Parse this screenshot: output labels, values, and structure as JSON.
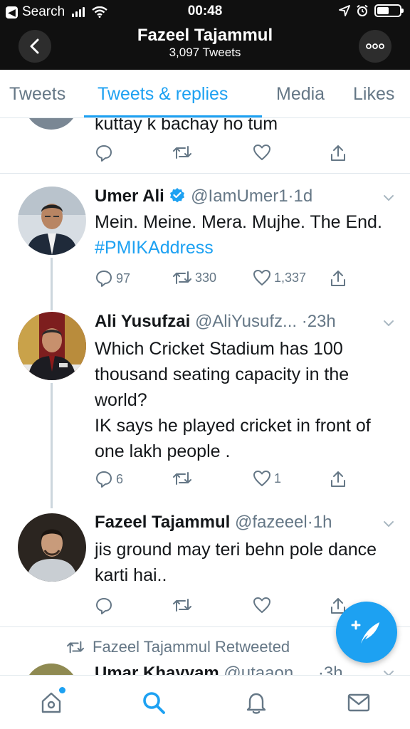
{
  "status_bar": {
    "back_app": "Search",
    "time": "00:48"
  },
  "header": {
    "name": "Fazeel Tajammul",
    "tweet_count": "3,097 Tweets"
  },
  "tabs": [
    {
      "label": "Tweets",
      "active": false
    },
    {
      "label": "Tweets & replies",
      "active": true
    },
    {
      "label": "Media",
      "active": false
    },
    {
      "label": "Likes",
      "active": false
    }
  ],
  "tweets": [
    {
      "text": "kuttay k bachay ho tum",
      "replies": "",
      "retweets": "",
      "likes": ""
    },
    {
      "name": "Umer Ali",
      "verified": true,
      "handle": "@IamUmer1",
      "time": "·1d",
      "text": "Mein. Meine. Mera. Mujhe. The End. ",
      "hashtag": "#PMIKAddress",
      "replies": "97",
      "retweets": "330",
      "likes": "1,337"
    },
    {
      "name": "Ali Yusufzai",
      "handle": "@AliYusufz...",
      "time": " ·23h",
      "text": "Which Cricket Stadium has 100 thousand seating capacity in the world?\nIK says he played cricket in front of one lakh people .",
      "replies": "6",
      "retweets": "",
      "likes": "1"
    },
    {
      "name": "Fazeel Tajammul",
      "handle": "@fazeeel",
      "time": "·1h",
      "text": "jis ground may teri behn pole dance karti hai..",
      "replies": "",
      "retweets": "",
      "likes": ""
    },
    {
      "retweeted_by": "Fazeel Tajammul Retweeted",
      "name": "Umar Khayyam",
      "handle": "@utaaon",
      "time": "·3h"
    }
  ],
  "colors": {
    "accent": "#1da1f2",
    "header_bg": "#101010",
    "verified": "#1da1f2",
    "muted": "#657786"
  }
}
